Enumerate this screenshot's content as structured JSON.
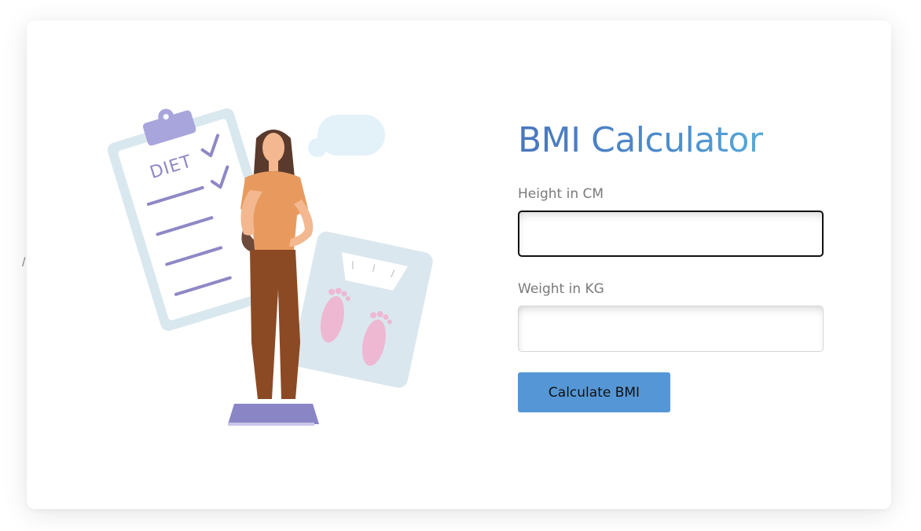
{
  "stray_text": "/",
  "calculator": {
    "title": "BMI Calculator",
    "height_label": "Height in CM",
    "height_value": "",
    "weight_label": "Weight in KG",
    "weight_value": "",
    "button_label": "Calculate BMI"
  },
  "illustration": {
    "clipboard_text": "DIET"
  },
  "colors": {
    "title_gradient_start": "#4a76bd",
    "title_gradient_end": "#5bc2e0",
    "button_bg": "#5597d6",
    "label_text": "#7a7a7a"
  }
}
